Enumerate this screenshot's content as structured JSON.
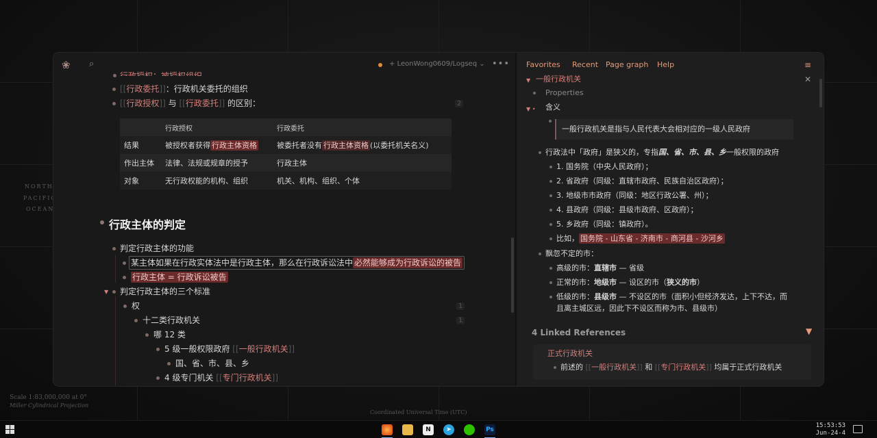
{
  "wallpaper": {
    "labels": [
      "NORTH",
      "PACIFIC",
      "OCEAN"
    ],
    "footer_line1": "Scale 1:83,000,000 at 0°",
    "footer_line2": "Miller Cylindrical Projection",
    "footer_center": "Coordinated Universal Time (UTC)"
  },
  "left": {
    "repo": "LeonWong0609/Logseq",
    "items": {
      "top_cut": "行政授权：被授权组织",
      "r1_ref": "行政委托",
      "r1_text": "：行政机关委托的组织",
      "r2_ref1": "行政授权",
      "r2_mid": "与",
      "r2_ref2": "行政委托",
      "r2_text": "的区别：",
      "r2_count": "2"
    },
    "table": {
      "header": [
        "",
        "行政授权",
        "行政委托"
      ],
      "rows": [
        {
          "label": "结果",
          "c1_pre": "被授权者获得",
          "c1_hl": "行政主体资格",
          "c2_pre": "被委托者没有",
          "c2_hl": "行政主体资格",
          "c2_post": "(以委托机关名义)"
        },
        {
          "label": "作出主体",
          "c1": "法律、法规或规章的授予",
          "c2": "行政主体"
        },
        {
          "label": "对象",
          "c1": "无行政权能的机构、组织",
          "c2": "机关、机构、组织、个体"
        }
      ]
    },
    "heading": "行政主体的判定",
    "b1": "判定行政主体的功能",
    "b1a_pre": "某主体如果在行政实体法中是行政主体，那么在行政诉讼法中",
    "b1a_hl": "必然能够成为行政诉讼的被告",
    "b1b_hl": "行政主体 = 行政诉讼被告",
    "b2": "判定行政主体的三个标准",
    "b2a": "权",
    "b2a_count": "1",
    "b2b": "十二类行政机关",
    "b2b_count": "1",
    "b2c": "哪 12 类",
    "b2d_pre": "5 级一般权限政府",
    "b2d_ref": "一般行政机关",
    "b2e": "国、省、市、县、乡",
    "b2f_pre": "4 级专门机关",
    "b2f_ref": "专门行政机关"
  },
  "right": {
    "nav": [
      "Favorites",
      "Recent",
      "Page graph",
      "Help"
    ],
    "page_title": "一般行政机关",
    "properties": "Properties",
    "meaning": "含义",
    "quote": "一般行政机关是指与人民代表大会相对应的一级人民政府",
    "law_pre": "行政法中「政府」是狭义的，专指",
    "law_bold": "国、省、市、县、乡",
    "law_post": "一般权限的政府",
    "levels": [
      {
        "pre": "1. ",
        "text": "国务院（中央人民政府）；"
      },
      {
        "pre": "2. ",
        "text": "省政府（同级：直辖市政府、民族自治区政府）；"
      },
      {
        "pre": "3. ",
        "text": "地级市市政府（同级：地区行政公署、州）；"
      },
      {
        "pre": "4. ",
        "text": "县政府（同级：县级市政府、区政府）；"
      },
      {
        "pre": "5. ",
        "text": "乡政府（同级：镇政府）。"
      }
    ],
    "example_pre": "比如，",
    "example_hl": "国务院 - 山东省 - 济南市 - 商河县 - 沙河乡",
    "city_title": "飘忽不定的市：",
    "cities": [
      {
        "pre": "高级的市：",
        "bold": "直辖市",
        "post": " — 省级"
      },
      {
        "pre": "正常的市：",
        "bold": "地级市",
        "post": " — 设区的市（",
        "bold2": "狭义的市",
        "post2": "）"
      },
      {
        "pre": "低级的市：",
        "bold": "县级市",
        "post": " — 不设区的市（面积小但经济发达，上下不达，而"
      }
    ],
    "city3_line2": "且离主城区远，因此下不设区而称为市、县级市）",
    "linked_title": "4 Linked References",
    "linked_page": "正式行政机关",
    "linked_pre": "前述的",
    "linked_ref1": "一般行政机关",
    "linked_mid": "和",
    "linked_ref2": "专门行政机关",
    "linked_post": "均属于正式行政机关"
  },
  "taskbar": {
    "time": "15:53:53",
    "date": "Jun-24-4",
    "apps": [
      "firefox-icon",
      "file-explorer-icon",
      "notion-icon",
      "telegram-icon",
      "wechat-icon",
      "photoshop-icon"
    ],
    "ps_label": "Ps",
    "notion_label": "N"
  }
}
